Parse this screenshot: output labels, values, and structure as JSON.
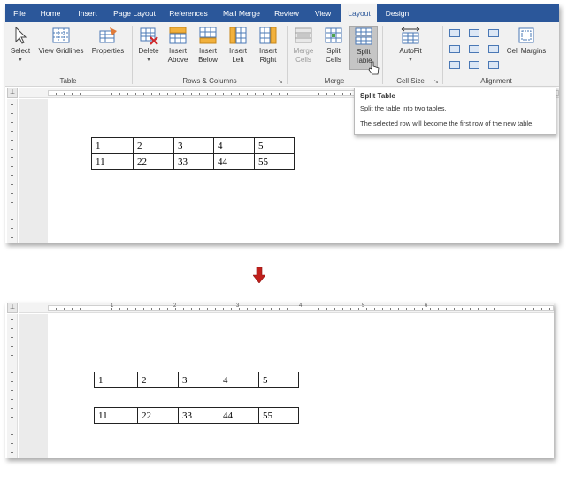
{
  "tabs": [
    {
      "label": "File",
      "active": false
    },
    {
      "label": "Home",
      "active": false
    },
    {
      "label": "Insert",
      "active": false
    },
    {
      "label": "Page Layout",
      "active": false
    },
    {
      "label": "References",
      "active": false
    },
    {
      "label": "Mail Merge",
      "active": false
    },
    {
      "label": "Review",
      "active": false
    },
    {
      "label": "View",
      "active": false
    },
    {
      "label": "Layout",
      "active": true
    },
    {
      "label": "Design",
      "active": false
    }
  ],
  "ribbon": {
    "select": {
      "label": "Select"
    },
    "view_gridlines": {
      "label": "View Gridlines"
    },
    "properties": {
      "label": "Properties"
    },
    "delete": {
      "label": "Delete"
    },
    "insert_above": {
      "line1": "Insert",
      "line2": "Above"
    },
    "insert_below": {
      "line1": "Insert",
      "line2": "Below"
    },
    "insert_left": {
      "line1": "Insert",
      "line2": "Left"
    },
    "insert_right": {
      "line1": "Insert",
      "line2": "Right"
    },
    "merge_cells": {
      "line1": "Merge",
      "line2": "Cells"
    },
    "split_cells": {
      "line1": "Split",
      "line2": "Cells"
    },
    "split_table": {
      "line1": "Split",
      "line2": "Table"
    },
    "autofit": {
      "label": "AutoFit"
    },
    "cell_margins": {
      "label": "Cell Margins"
    },
    "groups": {
      "table": "Table",
      "rows_columns": "Rows & Columns",
      "merge": "Merge",
      "cell_size": "Cell Size",
      "alignment": "Alignment"
    }
  },
  "tooltip": {
    "title": "Split Table",
    "line1": "Split the table into two tables.",
    "line2": "The selected row will become the first row of the new table."
  },
  "ruler": {
    "numbers": [
      "1",
      "2",
      "3",
      "4",
      "5",
      "6"
    ]
  },
  "before_table": {
    "rows": [
      [
        "1",
        "2",
        "3",
        "4",
        "5"
      ],
      [
        "11",
        "22",
        "33",
        "44",
        "55"
      ]
    ]
  },
  "after_table_1": {
    "rows": [
      [
        "1",
        "2",
        "3",
        "4",
        "5"
      ]
    ]
  },
  "after_table_2": {
    "rows": [
      [
        "11",
        "22",
        "33",
        "44",
        "55"
      ]
    ]
  },
  "colors": {
    "tab_bar": "#2b579a",
    "ribbon_bg": "#f1f1f1",
    "arrow": "#c0201c"
  }
}
